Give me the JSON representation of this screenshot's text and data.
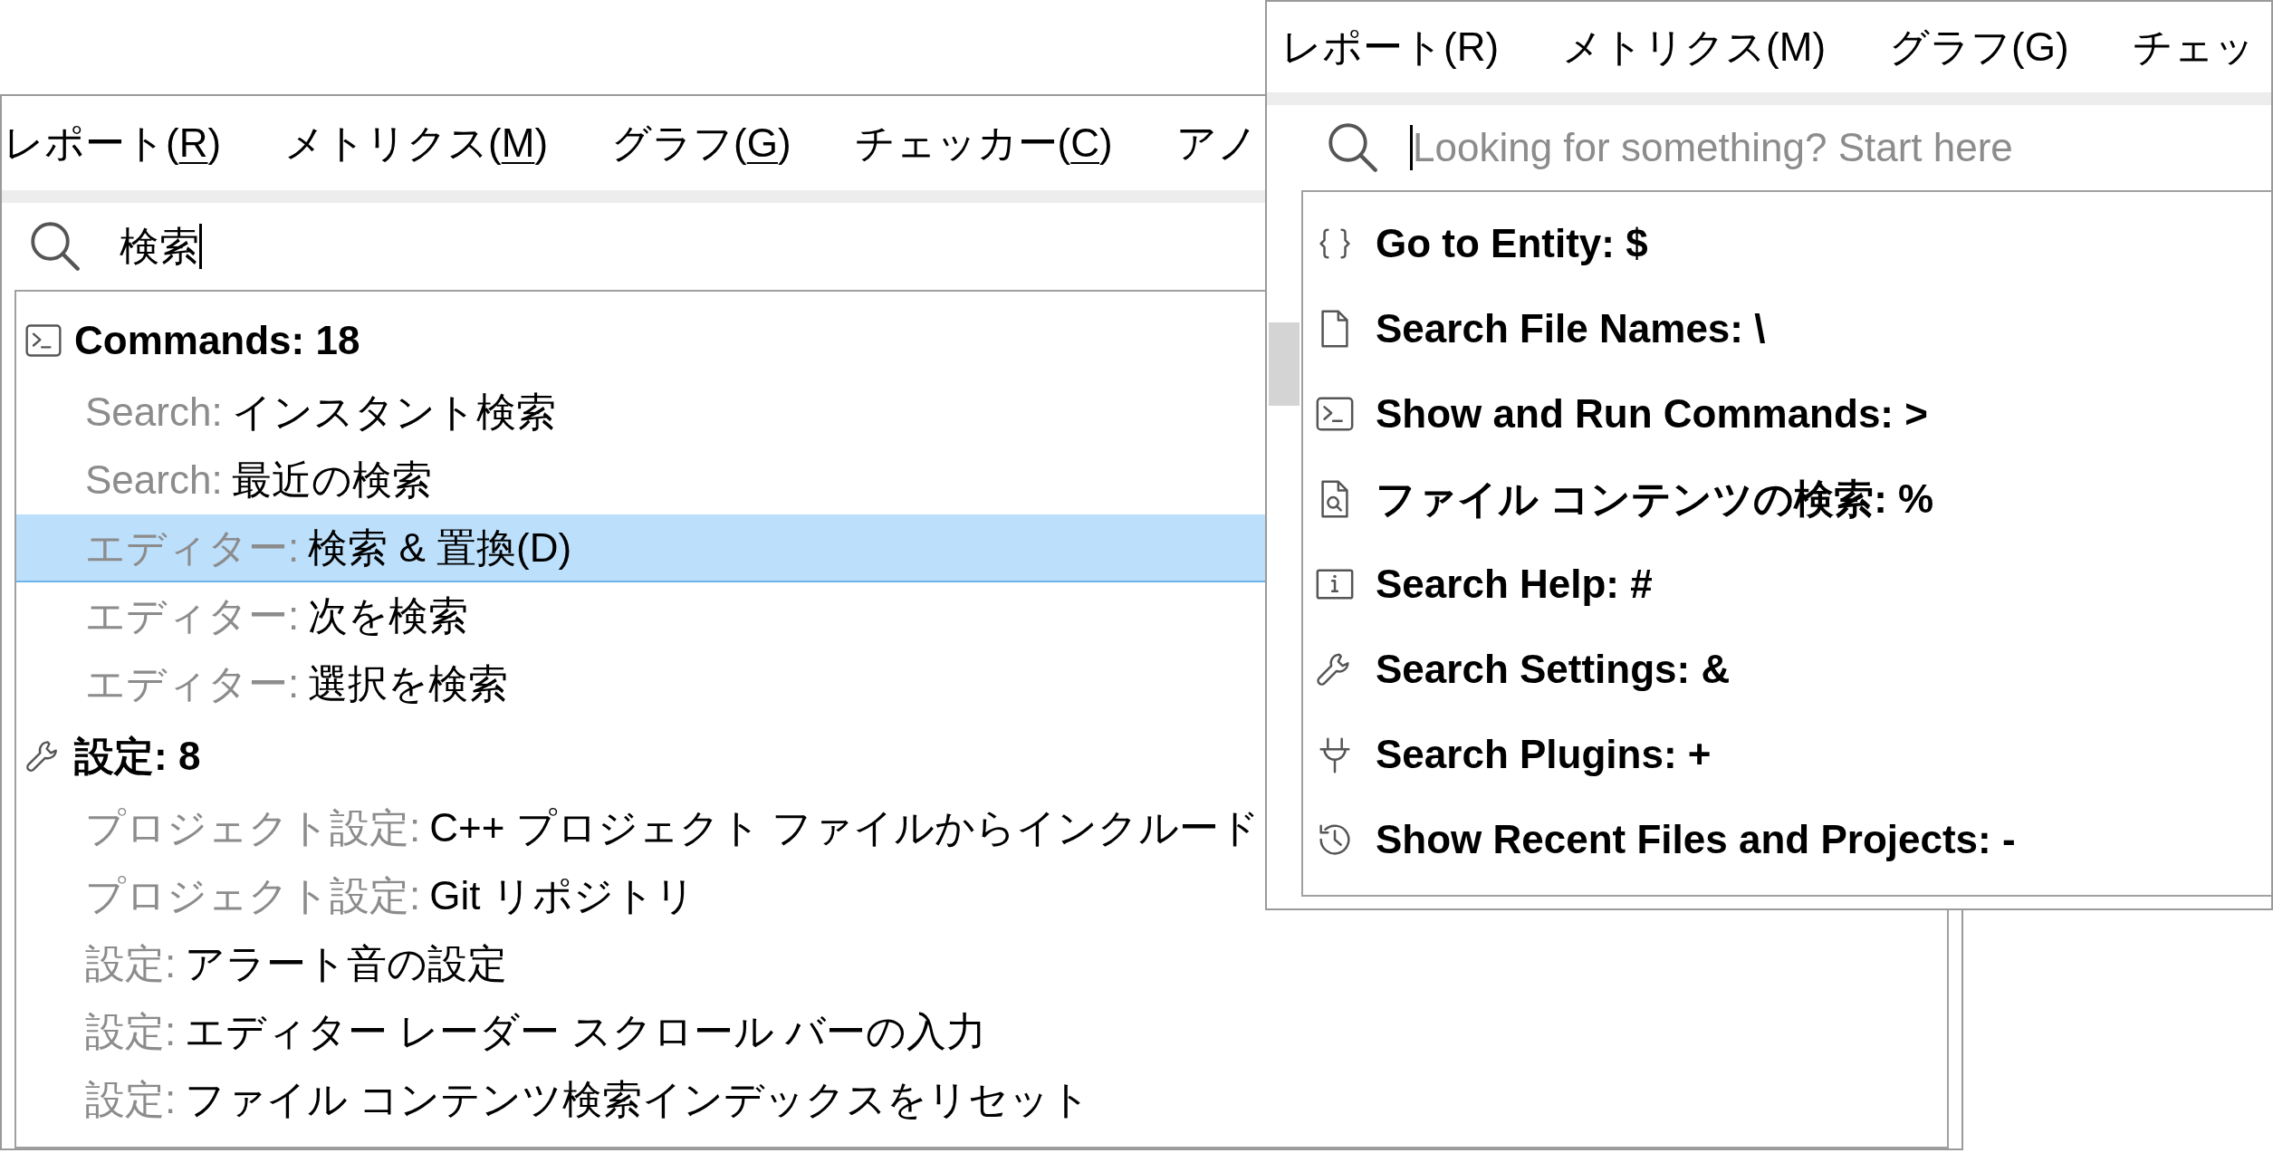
{
  "left_window": {
    "menu": {
      "mnemonics_shown": true,
      "items": [
        {
          "label": "レポート(R)"
        },
        {
          "label": "メトリクス(M)"
        },
        {
          "label": "グラフ(G)"
        },
        {
          "label": "チェッカー(C)"
        },
        {
          "label": "アノ"
        }
      ]
    },
    "search": {
      "value": "検索"
    },
    "groups": [
      {
        "kind": "commands",
        "title": "Commands: 18",
        "items": [
          {
            "category": "Search:",
            "text": "インスタント検索",
            "selected": false
          },
          {
            "category": "Search:",
            "text": "最近の検索",
            "selected": false
          },
          {
            "category": "エディター:",
            "text": "検索 & 置換(D)",
            "selected": true
          },
          {
            "category": "エディター:",
            "text": "次を検索",
            "selected": false
          },
          {
            "category": "エディター:",
            "text": "選択を検索",
            "selected": false
          }
        ]
      },
      {
        "kind": "settings",
        "title": "設定: 8",
        "items": [
          {
            "category": "プロジェクト設定:",
            "text": "C++ プロジェクト ファイルからインクルード",
            "selected": false
          },
          {
            "category": "プロジェクト設定:",
            "text": "Git リポジトリ",
            "selected": false
          },
          {
            "category": "設定:",
            "text": "アラート音の設定",
            "selected": false
          },
          {
            "category": "設定:",
            "text": "エディター レーダー スクロール バーの入力",
            "selected": false
          },
          {
            "category": "設定:",
            "text": "ファイル コンテンツ検索インデックスをリセット",
            "selected": false
          }
        ]
      }
    ]
  },
  "right_window": {
    "menu": {
      "mnemonics_shown": false,
      "items": [
        {
          "label": "レポート(R)"
        },
        {
          "label": "メトリクス(M)"
        },
        {
          "label": "グラフ(G)"
        },
        {
          "label": "チェッ"
        }
      ]
    },
    "search": {
      "placeholder": "Looking for something? Start here"
    },
    "options": [
      {
        "kind": "entity",
        "label": "Go to Entity: $"
      },
      {
        "kind": "file",
        "label": "Search File Names: \\"
      },
      {
        "kind": "commands",
        "label": "Show and Run Commands: >"
      },
      {
        "kind": "contents",
        "label": "ファイル コンテンツの検索: %"
      },
      {
        "kind": "help",
        "label": "Search Help: #"
      },
      {
        "kind": "settings",
        "label": "Search Settings: &"
      },
      {
        "kind": "plugins",
        "label": "Search Plugins: +"
      },
      {
        "kind": "recent",
        "label": "Show Recent Files and Projects: -"
      }
    ]
  }
}
